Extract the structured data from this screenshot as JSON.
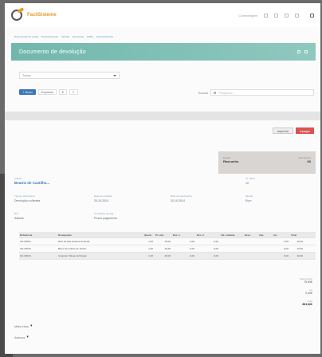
{
  "app": {
    "logo_text": "FacilSisteme"
  },
  "topbar": {
    "user_label": "Conecvegem"
  },
  "breadcrumb": [
    "Documentos de venda",
    "Descontamento",
    "Vendas",
    "Devolucao",
    "Editar",
    "Descontamento"
  ],
  "banner": {
    "title": "Documento de devolução"
  },
  "filter": {
    "selected": "Todos"
  },
  "toolbar": {
    "new_label": "+ Novo",
    "second_label": "Exportar",
    "third_label": "▾",
    "fourth_label": "Ξ"
  },
  "search": {
    "label": "Buscar",
    "placeholder": "Pesquisar..."
  },
  "actions": {
    "print_label": "Imprimir",
    "delete_label": "Apagar"
  },
  "summary": {
    "status_label": "Estado",
    "status_value": "Rascunho",
    "number_label": "Documento",
    "number_value": "83"
  },
  "fields": {
    "client_label": "Cliente",
    "client_value": "Beatriz de Castilho...",
    "series_label": "Nr. Série",
    "series_value": "10",
    "doc_type_label": "Tipo de documento",
    "doc_type_value": "Devolução a clientes",
    "issue_date_label": "Data de emissão",
    "issue_date_value": "20-10-2014",
    "due_date_label": "Data de vencimento",
    "due_date_value": "20-10-2014",
    "currency_label": "Moeda",
    "currency_value": "Euro",
    "ref_label": "Ref.",
    "ref_value": "Adiante",
    "payment_label": "Condições de pag.",
    "payment_value": "Pronto pagamento"
  },
  "table": {
    "headers": [
      "Referência",
      "Designação",
      "Quant.",
      "Pr. unit.",
      "Des. 1",
      "Des. 2",
      "Val. unidade",
      "Desc.",
      "Imp.",
      "Iva",
      "Total"
    ],
    "rows": [
      [
        "CD-00004",
        "Rolo de Fita Isolante Amarela",
        "1,00",
        "16,00",
        "0,00",
        "0,00",
        "",
        "",
        "",
        "0,00",
        "16,00"
      ],
      [
        "CD-00015",
        "Bloco de Folhas de Tecido",
        "1,00",
        "19,99",
        "0,00",
        "0,00",
        "",
        "",
        "",
        "0,00",
        "19,99"
      ],
      [
        "CD-00024",
        "Conjunto Tábua de Passar",
        "1,00",
        "40,00",
        "0,00",
        "0,00",
        "",
        "",
        "",
        "0,00",
        "40,00"
      ]
    ]
  },
  "totals": [
    {
      "label": "Total ilíquido",
      "value": "75,99€"
    },
    {
      "label": "Iva",
      "value": "0,00€"
    },
    {
      "label": "Total",
      "value": "883,86€"
    }
  ],
  "footer": {
    "link1": "Mais infos",
    "link2": "Anexos"
  }
}
